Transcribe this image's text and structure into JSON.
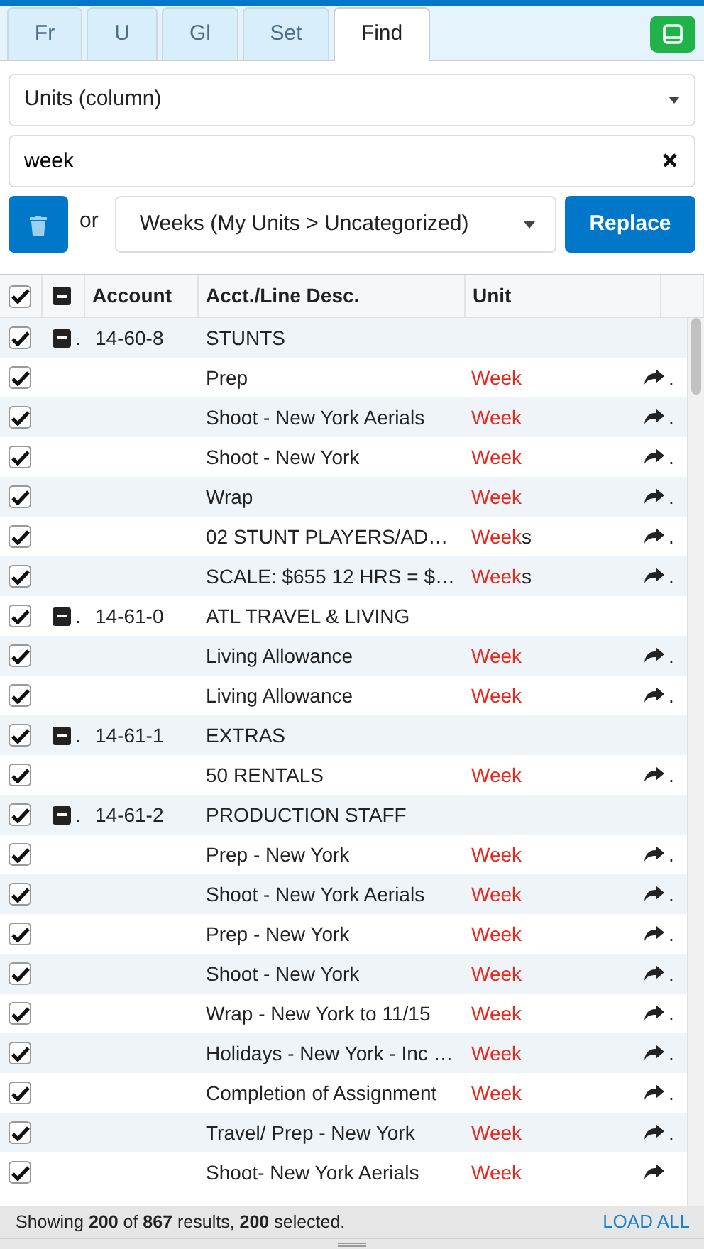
{
  "tabs": [
    {
      "label": "Fr",
      "selected": false
    },
    {
      "label": "U",
      "selected": false
    },
    {
      "label": "Gl",
      "selected": false
    },
    {
      "label": "Set",
      "selected": false
    },
    {
      "label": "Find",
      "selected": true
    }
  ],
  "find": {
    "column_select": "Units (column)",
    "search_value": "week",
    "connector": "or",
    "replace_select": "Weeks (My Units > Uncategorized)",
    "replace_button": "Replace"
  },
  "table": {
    "all_checked": true,
    "columns": [
      "Account",
      "Acct./Line Desc.",
      "Unit"
    ],
    "rows": [
      {
        "kind": "group",
        "checked": true,
        "expanded": true,
        "dot": ".",
        "account": "14-60-8",
        "desc": "STUNTS"
      },
      {
        "kind": "line",
        "checked": true,
        "desc": "Prep",
        "unit_match": "Week",
        "tail": "."
      },
      {
        "kind": "line",
        "checked": true,
        "desc": "Shoot - New York Aerials",
        "unit_match": "Week",
        "tail": "."
      },
      {
        "kind": "line",
        "checked": true,
        "desc": "Shoot - New York",
        "unit_match": "Week",
        "tail": "."
      },
      {
        "kind": "line",
        "checked": true,
        "desc": "Wrap",
        "unit_match": "Week",
        "tail": "."
      },
      {
        "kind": "line",
        "checked": true,
        "desc": "02 STUNT PLAYERS/AD…",
        "unit_match": "Week",
        "unit_rest": "s",
        "tail": "."
      },
      {
        "kind": "line",
        "checked": true,
        "desc": "SCALE: $655 12 HRS = $…",
        "unit_match": "Week",
        "unit_rest": "s",
        "tail": "."
      },
      {
        "kind": "group",
        "checked": true,
        "expanded": true,
        "dot": ".",
        "account": "14-61-0",
        "desc": "ATL TRAVEL & LIVING"
      },
      {
        "kind": "line",
        "checked": true,
        "desc": "Living Allowance",
        "unit_match": "Week",
        "tail": "."
      },
      {
        "kind": "line",
        "checked": true,
        "desc": "Living Allowance",
        "unit_match": "Week",
        "tail": "."
      },
      {
        "kind": "group",
        "checked": true,
        "expanded": true,
        "dot": ".",
        "account": "14-61-1",
        "desc": "EXTRAS"
      },
      {
        "kind": "line",
        "checked": true,
        "desc": "50 RENTALS",
        "unit_match": "Week",
        "tail": "."
      },
      {
        "kind": "group",
        "checked": true,
        "expanded": true,
        "dot": ".",
        "account": "14-61-2",
        "desc": "PRODUCTION STAFF"
      },
      {
        "kind": "line",
        "checked": true,
        "desc": "Prep - New York",
        "unit_match": "Week",
        "tail": "."
      },
      {
        "kind": "line",
        "checked": true,
        "desc": "Shoot - New York Aerials",
        "unit_match": "Week",
        "tail": "."
      },
      {
        "kind": "line",
        "checked": true,
        "desc": "Prep - New York",
        "unit_match": "Week",
        "tail": "."
      },
      {
        "kind": "line",
        "checked": true,
        "desc": "Shoot - New York",
        "unit_match": "Week",
        "tail": "."
      },
      {
        "kind": "line",
        "checked": true,
        "desc": "Wrap - New York to 11/15",
        "unit_match": "Week",
        "tail": "."
      },
      {
        "kind": "line",
        "checked": true,
        "desc": "Holidays - New York - Inc …",
        "unit_match": "Week",
        "tail": "."
      },
      {
        "kind": "line",
        "checked": true,
        "desc": "Completion of Assignment",
        "unit_match": "Week",
        "tail": "."
      },
      {
        "kind": "line",
        "checked": true,
        "desc": "Travel/ Prep - New York",
        "unit_match": "Week",
        "tail": "."
      },
      {
        "kind": "line",
        "checked": true,
        "desc": "Shoot- New York Aerials",
        "unit_match": "Week"
      }
    ]
  },
  "status_bar": {
    "summary": "Showing **200** of **867** results, **200** selected.",
    "load_all": "LOAD ALL"
  }
}
